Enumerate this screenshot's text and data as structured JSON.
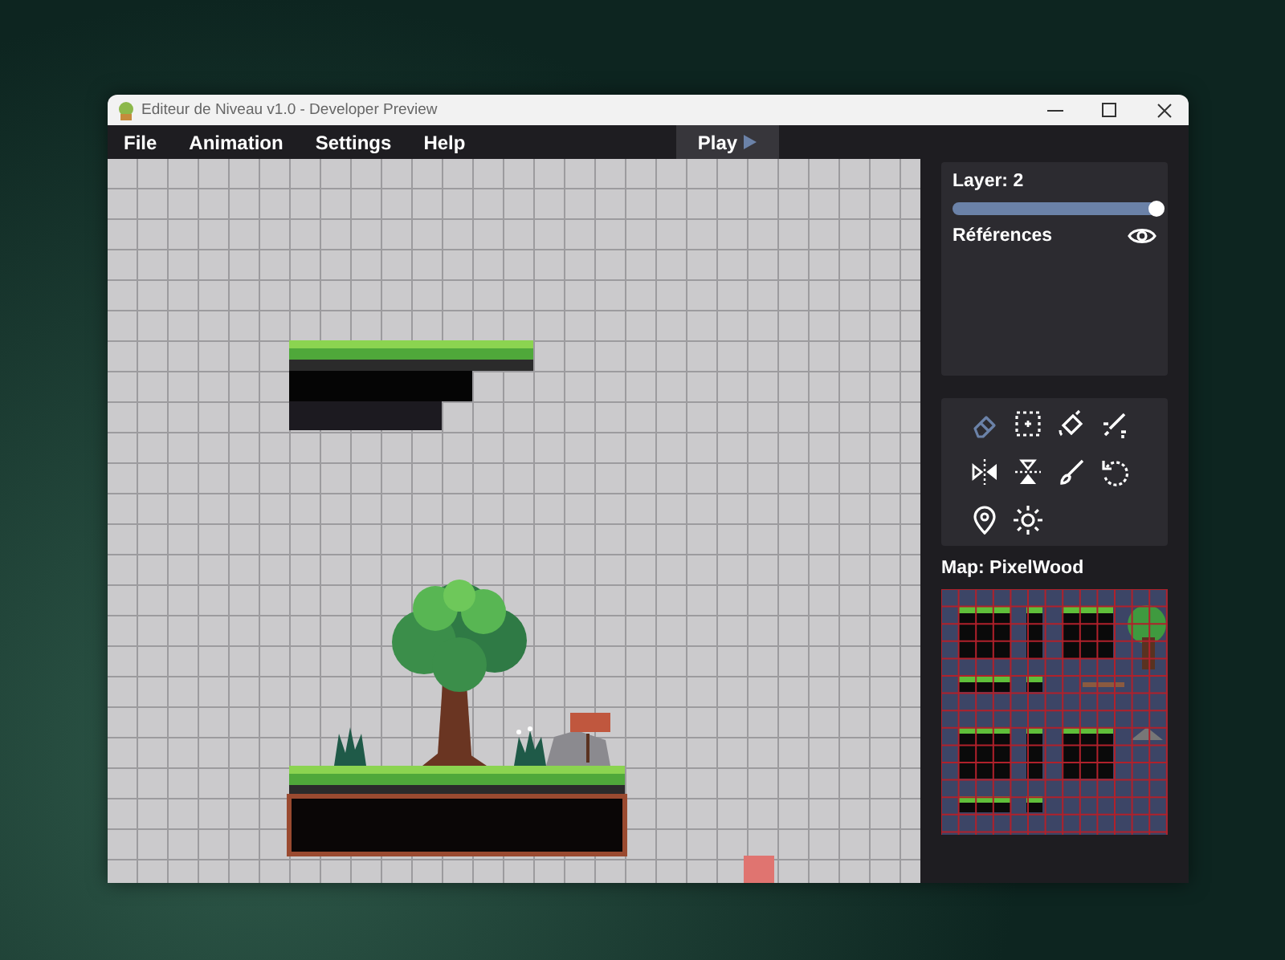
{
  "window": {
    "title": "Editeur de Niveau v1.0 - Developer Preview"
  },
  "menu": [
    {
      "label": "File"
    },
    {
      "label": "Animation"
    },
    {
      "label": "Settings"
    },
    {
      "label": "Help"
    }
  ],
  "play_button": {
    "label": "Play"
  },
  "layer_panel": {
    "title": "Layer: 2",
    "slider": {
      "level": 1.0
    },
    "references": {
      "label": "Références",
      "visible": true
    }
  },
  "tools": [
    {
      "selected": true
    },
    {
      "selected": false
    },
    {
      "selected": false
    },
    {
      "selected": false
    },
    {
      "selected": false
    },
    {
      "selected": false
    },
    {
      "selected": false
    },
    {
      "selected": false
    },
    {
      "selected": false
    },
    {
      "selected": false
    }
  ],
  "map": {
    "title": "Map: PixelWood"
  }
}
